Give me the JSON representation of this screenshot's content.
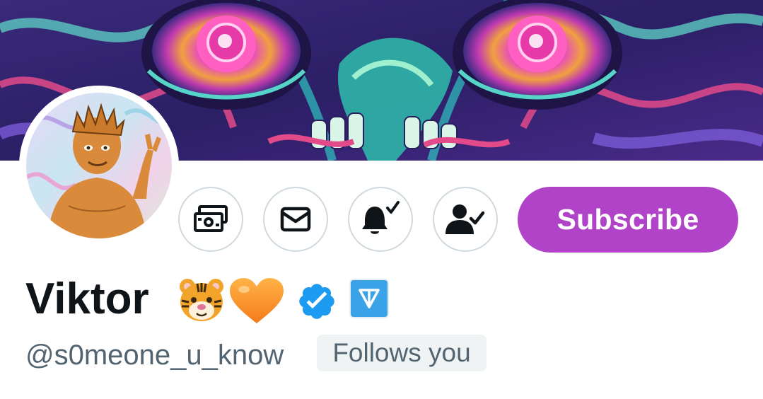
{
  "banner": {
    "alt": "psychedelic eyes header image"
  },
  "avatar": {
    "alt": "profile picture"
  },
  "actions": {
    "tip_icon": "money-icon",
    "message_icon": "envelope-icon",
    "notifications_icon": "bell-check-icon",
    "following_icon": "person-check-icon",
    "subscribe_label": "Subscribe"
  },
  "profile": {
    "display_name": "Viktor",
    "emoji": [
      "tiger-face-emoji",
      "orange-heart-emoji"
    ],
    "verified_badge": "verified-badge-icon",
    "affiliate_badge": "ton-logo-icon",
    "handle": "@s0meone_u_know",
    "follows_you_label": "Follows you"
  },
  "colors": {
    "subscribe_bg": "#b043c8",
    "verified_blue": "#1d9bf0",
    "text_primary": "#0f1419",
    "text_secondary": "#536471",
    "icon_border": "#cfd9de"
  }
}
